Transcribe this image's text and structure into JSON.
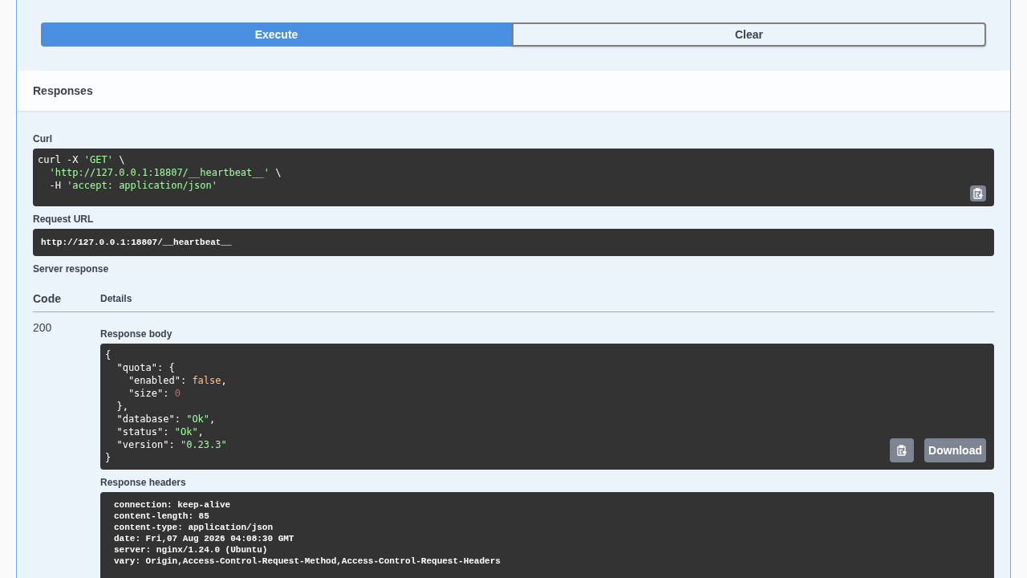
{
  "buttons": [
    {
      "label": "Execute",
      "kind": "primary"
    },
    {
      "label": "Clear",
      "kind": "secondary"
    }
  ],
  "responses": {
    "title": "Responses",
    "curl": {
      "label": "Curl",
      "lines": [
        [
          {
            "text": "curl -X ",
            "kind": "plain"
          },
          {
            "text": "'GET'",
            "kind": "string"
          },
          {
            "text": " \\",
            "kind": "plain"
          }
        ],
        [
          {
            "text": "  'http://127.0.0.1:18807/__heartbeat__'",
            "kind": "string"
          },
          {
            "text": " \\",
            "kind": "plain"
          }
        ],
        [
          {
            "text": "  -H ",
            "kind": "plain"
          },
          {
            "text": "'accept: application/json'",
            "kind": "string"
          }
        ]
      ]
    },
    "request_url": {
      "label": "Request URL",
      "value": "http://127.0.0.1:18807/__heartbeat__"
    },
    "server_response": {
      "label": "Server response",
      "columns": [
        "Code",
        "Details"
      ],
      "code": "200",
      "body": {
        "label": "Response body",
        "download": "Download",
        "lines": [
          [
            {
              "text": "{",
              "kind": "plain"
            }
          ],
          [
            {
              "text": "  \"quota\": {",
              "kind": "plain"
            }
          ],
          [
            {
              "text": "    \"enabled\": ",
              "kind": "plain"
            },
            {
              "text": "false",
              "kind": "literal"
            },
            {
              "text": ",",
              "kind": "plain"
            }
          ],
          [
            {
              "text": "    \"size\": ",
              "kind": "plain"
            },
            {
              "text": "0",
              "kind": "number"
            }
          ],
          [
            {
              "text": "  },",
              "kind": "plain"
            }
          ],
          [
            {
              "text": "  \"database\": ",
              "kind": "plain"
            },
            {
              "text": "\"Ok\"",
              "kind": "string"
            },
            {
              "text": ",",
              "kind": "plain"
            }
          ],
          [
            {
              "text": "  \"status\": ",
              "kind": "plain"
            },
            {
              "text": "\"Ok\"",
              "kind": "string"
            },
            {
              "text": ",",
              "kind": "plain"
            }
          ],
          [
            {
              "text": "  \"version\": ",
              "kind": "plain"
            },
            {
              "text": "\"0.23.3\"",
              "kind": "string"
            }
          ],
          [
            {
              "text": "}",
              "kind": "plain"
            }
          ]
        ]
      },
      "headers": {
        "label": "Response headers",
        "lines": [
          "connection: keep-alive",
          "content-length: 85",
          "content-type: application/json",
          "date: Fri,07 Aug 2026 04:08:30 GMT",
          "server: nginx/1.24.0 (Ubuntu)",
          "vary: Origin,Access-Control-Request-Method,Access-Control-Request-Headers"
        ]
      }
    }
  }
}
